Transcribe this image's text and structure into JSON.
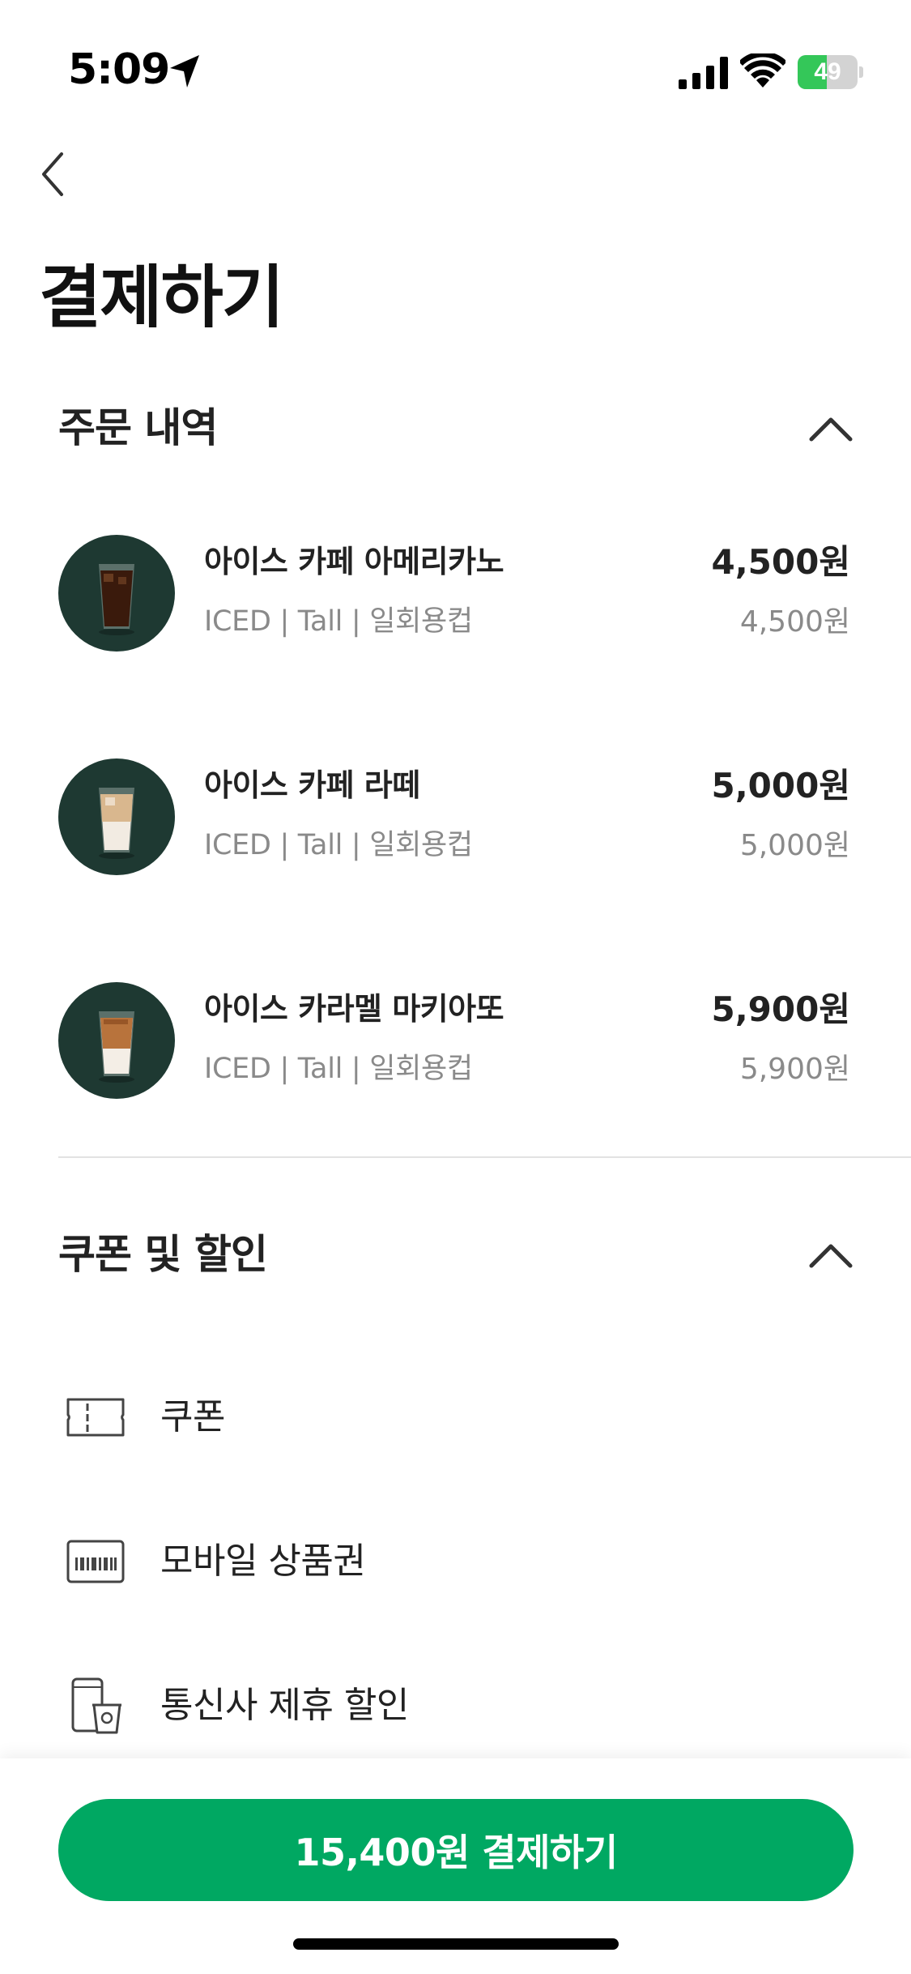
{
  "status_bar": {
    "time": "5:09",
    "battery_level": "49",
    "battery_fraction": 0.49,
    "battery_charging": true
  },
  "header": {
    "back_icon": "chevron-left-icon",
    "title": "결제하기"
  },
  "order_section": {
    "title": "주문 내역",
    "toggle_icon": "chevron-up-icon",
    "items": [
      {
        "name": "아이스 카페 아메리카노",
        "options": "ICED | Tall | 일회용컵",
        "price": "4,500원",
        "subprice": "4,500원",
        "drink_color": "#3a1a0c"
      },
      {
        "name": "아이스 카페 라떼",
        "options": "ICED | Tall | 일회용컵",
        "price": "5,000원",
        "subprice": "5,000원",
        "drink_color": "#d9b78e"
      },
      {
        "name": "아이스 카라멜 마키아또",
        "options": "ICED | Tall | 일회용컵",
        "price": "5,900원",
        "subprice": "5,900원",
        "drink_color": "#b8733c"
      }
    ]
  },
  "discount_section": {
    "title": "쿠폰 및 할인",
    "toggle_icon": "chevron-up-icon",
    "rows": [
      {
        "label": "쿠폰",
        "icon": "ticket-icon"
      },
      {
        "label": "모바일 상품권",
        "icon": "gift-card-icon"
      },
      {
        "label": "통신사 제휴 할인",
        "icon": "phone-cup-icon"
      }
    ]
  },
  "footer": {
    "pay_label": "15,400원 결제하기"
  },
  "colors": {
    "brand_green": "#00a862",
    "thumb_bg": "#1e3932",
    "battery_green": "#34c759"
  }
}
